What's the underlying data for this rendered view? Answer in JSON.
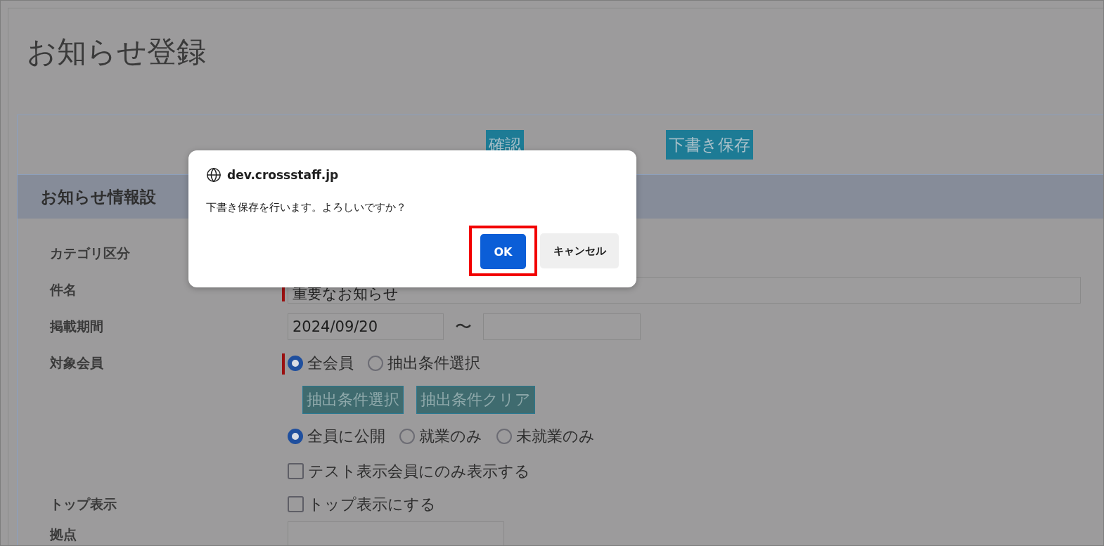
{
  "page": {
    "title": "お知らせ登録"
  },
  "toolbar": {
    "buttons": [
      "確認",
      "下書き保存"
    ]
  },
  "section": {
    "heading": "お知らせ情報設"
  },
  "form": [
    {
      "kind": "blank",
      "label": "カテゴリ区分"
    },
    {
      "kind": "text",
      "label": "件名",
      "required": true,
      "value": "重要なお知らせ"
    },
    {
      "kind": "date_range",
      "label": "掲載期間",
      "from": "2024/09/20",
      "separator": "〜"
    },
    {
      "kind": "radio",
      "label": "対象会員",
      "required": true,
      "options": [
        {
          "label": "全会員",
          "selected": true
        },
        {
          "label": "抽出条件選択",
          "selected": false
        }
      ]
    },
    {
      "kind": "buttons",
      "buttons": [
        "抽出条件選択",
        "抽出条件クリア"
      ]
    },
    {
      "kind": "radio",
      "options": [
        {
          "label": "全員に公開",
          "selected": true
        },
        {
          "label": "就業のみ",
          "selected": false
        },
        {
          "label": "未就業のみ",
          "selected": false
        }
      ]
    },
    {
      "kind": "checkbox",
      "options": [
        {
          "label": "テスト表示会員にのみ表示する",
          "checked": false
        }
      ]
    },
    {
      "kind": "checkbox",
      "label": "トップ表示",
      "options": [
        {
          "label": "トップ表示にする",
          "checked": false
        }
      ]
    },
    {
      "kind": "empty",
      "label": "拠点"
    }
  ],
  "dialog": {
    "origin": "dev.crossstaff.jp",
    "message": "下書き保存を行います。よろしいですか？",
    "ok": "OK",
    "cancel": "キャンセル",
    "ok_highlighted": true
  }
}
